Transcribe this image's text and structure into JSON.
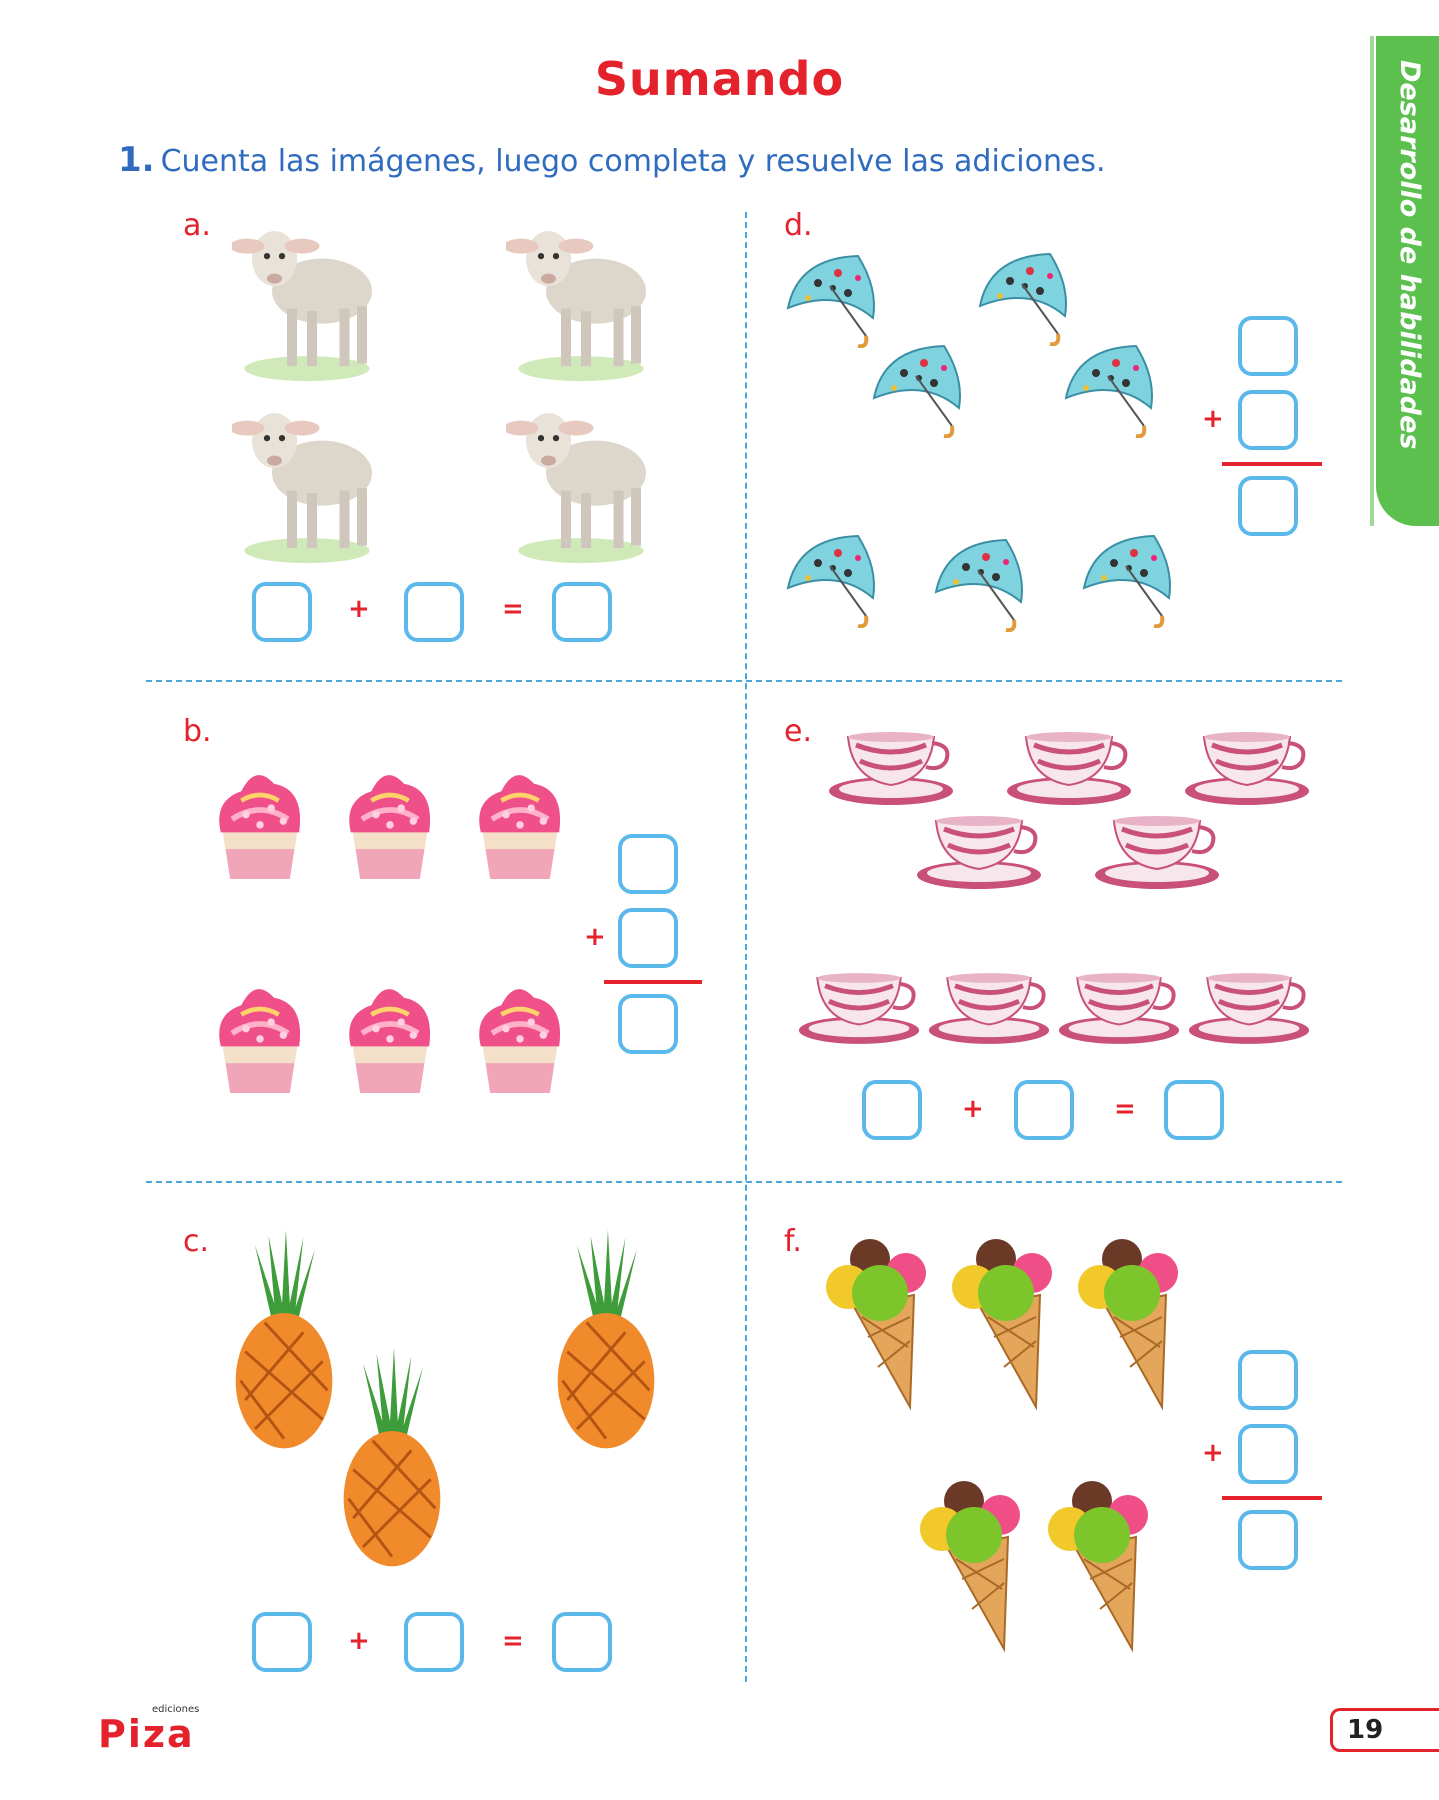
{
  "title": "Sumando",
  "instruction": {
    "number": "1.",
    "text": "Cuenta las imágenes, luego completa y resuelve las adiciones."
  },
  "side_tab": "Desarrollo de habilidades",
  "exercises": {
    "a": {
      "letter": "a.",
      "items": "sheep",
      "plus": "+",
      "equals": "="
    },
    "b": {
      "letter": "b.",
      "items": "cupcakes",
      "plus": "+"
    },
    "c": {
      "letter": "c.",
      "items": "pineapples",
      "plus": "+",
      "equals": "="
    },
    "d": {
      "letter": "d.",
      "items": "umbrellas",
      "plus": "+"
    },
    "e": {
      "letter": "e.",
      "items": "teacups",
      "plus": "+",
      "equals": "="
    },
    "f": {
      "letter": "f.",
      "items": "ice-creams",
      "plus": "+"
    }
  },
  "footer": {
    "logo_small": "ediciones",
    "logo": "Piza",
    "page_number": "19"
  },
  "colors": {
    "title": "#e3222c",
    "instruction": "#2f6bbf",
    "tab": "#5cc04f",
    "box": "#5bb8ea",
    "divider": "#4aa7d6"
  }
}
